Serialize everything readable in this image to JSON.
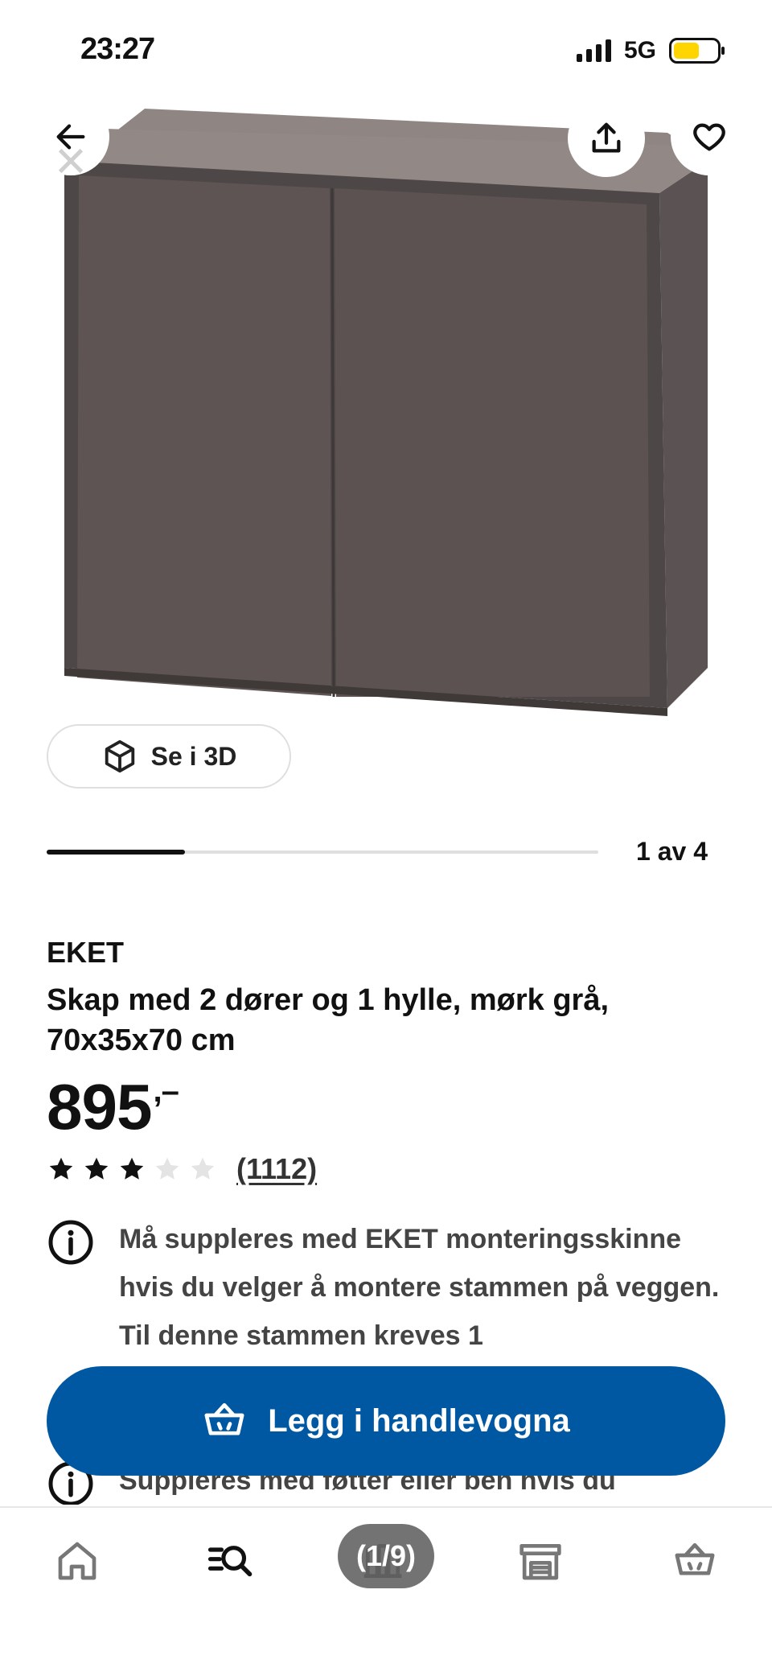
{
  "status_bar": {
    "time": "23:27",
    "network": "5G",
    "battery_level": 0.6,
    "battery_color": "#ffd500"
  },
  "header": {
    "back_icon": "arrow-left-icon",
    "close_icon": "close-icon",
    "share_icon": "share-icon",
    "favourite_icon": "heart-icon"
  },
  "gallery": {
    "view_3d_label": "Se i 3D",
    "view_3d_icon": "cube-icon",
    "current_index": 1,
    "total": 4,
    "pager_label": "1 av 4",
    "progress": 0.25
  },
  "product": {
    "brand": "EKET",
    "description": "Skap med 2 dører og 1 hylle, mørk grå, 70x35x70 cm",
    "price": "895",
    "price_suffix": ",–",
    "rating_filled": 3,
    "rating_max": 5,
    "review_count": "(1112)",
    "info_notes": [
      "Må suppleres med EKET monteringsskinne hvis du velger å montere stammen på veggen. Til denne stammen kreves 1",
      "Suppleres med føtter eller ben hvis du"
    ],
    "info_icon": "info-icon"
  },
  "cta": {
    "add_to_cart_label": "Legg i handlevogna",
    "add_to_cart_icon": "basket-icon",
    "brand_color": "#0058a3"
  },
  "bottom_nav": {
    "items": [
      {
        "icon": "home-icon"
      },
      {
        "icon": "search-icon"
      },
      {
        "icon": "rooms-icon"
      },
      {
        "icon": "store-icon"
      },
      {
        "icon": "cart-icon"
      }
    ],
    "overlay_badge": "(1/9)"
  }
}
